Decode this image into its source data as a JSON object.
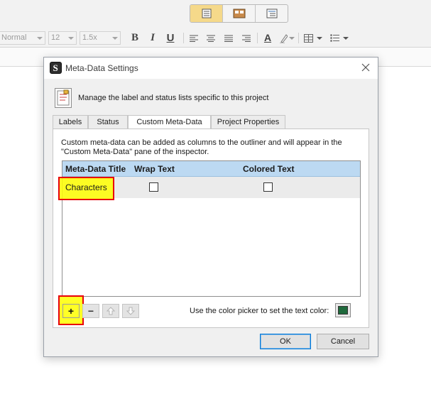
{
  "app": {
    "format_bar": {
      "style_value": "Normal",
      "size_value": "12",
      "spacing_value": "1.5x",
      "bold_label": "B",
      "italic_label": "I",
      "underline_label": "U",
      "text_color_label": "A"
    }
  },
  "dialog": {
    "title": "Meta-Data Settings",
    "intro": "Manage the label and status lists specific to this project",
    "tabs": [
      {
        "label": "Labels"
      },
      {
        "label": "Status"
      },
      {
        "label": "Custom Meta-Data",
        "selected": true
      },
      {
        "label": "Project Properties"
      }
    ],
    "description": "Custom meta-data can be added as columns to the outliner and will appear in the \"Custom Meta-Data\" pane of the inspector.",
    "table": {
      "columns": [
        "Meta-Data Title",
        "Wrap Text",
        "Colored Text"
      ],
      "rows": [
        {
          "title": "Characters",
          "wrap_text": false,
          "colored_text": false
        }
      ]
    },
    "controls": {
      "add_label": "+",
      "remove_label": "−"
    },
    "color_picker_label": "Use the color picker to set the text color:",
    "text_color": "#1e6a3c",
    "ok_label": "OK",
    "cancel_label": "Cancel"
  },
  "colors": {
    "highlight_fill": "#ffff00",
    "highlight_border": "#e8000b",
    "table_header": "#bcd9f2",
    "active_view_button": "#f5d98a"
  }
}
